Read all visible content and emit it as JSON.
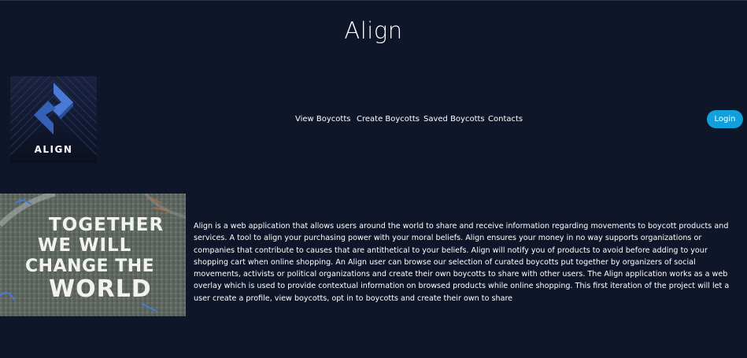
{
  "header": {
    "title": "Align"
  },
  "logo": {
    "text": "ALIGN",
    "icon": "align-diamond-logo-icon"
  },
  "nav": {
    "items": [
      {
        "label": "View Boycotts"
      },
      {
        "label": "Create Boycotts"
      },
      {
        "label": "Saved Boycotts"
      },
      {
        "label": "Contacts"
      }
    ],
    "login_label": "Login"
  },
  "hero": {
    "image_text_lines": [
      "TOGETHER",
      "WE WILL",
      "CHANGE THE",
      "WORLD"
    ],
    "description": "Align is a web application that allows users around the world to share and receive information regarding movements to boycott products and services. A tool to align your purchasing power with your moral beliefs. Align ensures your money in no way supports organizations or companies that contribute to causes that are antithetical to your beliefs. Align will notify you of products to avoid before adding to your shopping cart when online shopping. An Align user can browse our selection of curated boycotts put together by organizers of social movements, activists or political organizations and create their own boycotts to share with other users. The Align application works as a web overlay which is used to provide contextual information on browsed products while online shopping. This first iteration of the project will let a user create a profile, view boycotts, opt in to boycotts and create their own to share"
  },
  "colors": {
    "background": "#0f1629",
    "login_button": "#11a0dc",
    "logo_blue": "#3f6fc8"
  }
}
